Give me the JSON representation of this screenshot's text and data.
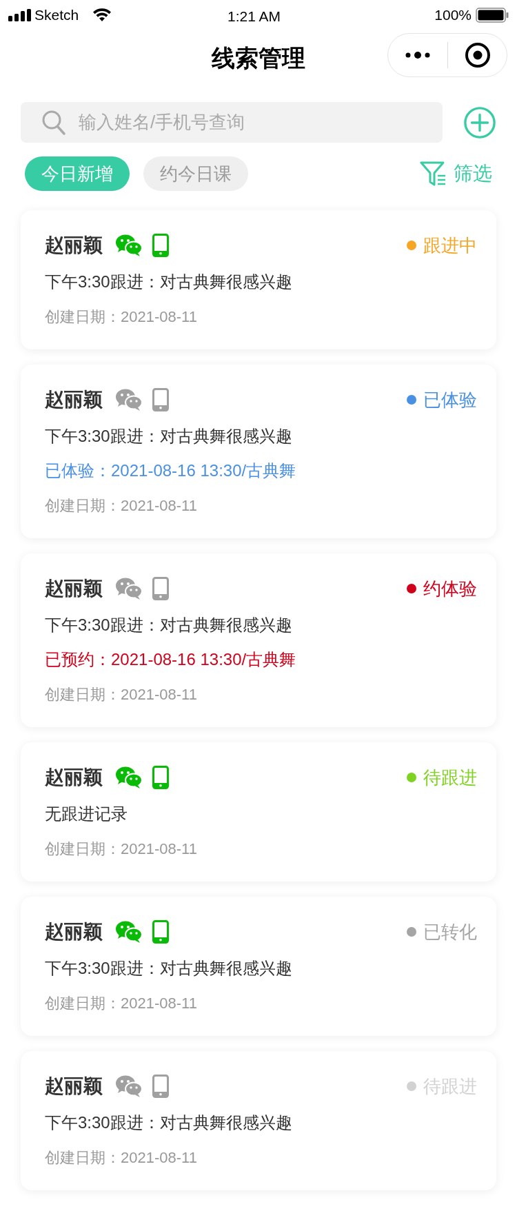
{
  "status_bar": {
    "carrier": "Sketch",
    "time": "1:21 AM",
    "battery": "100%"
  },
  "nav": {
    "title": "线索管理"
  },
  "search": {
    "placeholder": "输入姓名/手机号查询"
  },
  "chips": [
    {
      "label": "今日新增",
      "selected": true
    },
    {
      "label": "约今日课",
      "selected": false
    }
  ],
  "filter": {
    "label": "筛选"
  },
  "cards": [
    {
      "name": "赵丽颖",
      "wechat_linked": true,
      "phone_linked": true,
      "status": {
        "label": "跟进中",
        "color": "#f5a623"
      },
      "follow_up": "下午3:30跟进：对古典舞很感兴趣",
      "created": "创建日期：2021-08-11"
    },
    {
      "name": "赵丽颖",
      "wechat_linked": false,
      "phone_linked": false,
      "status": {
        "label": "已体验",
        "color": "#4a90e2"
      },
      "follow_up": "下午3:30跟进：对古典舞很感兴趣",
      "booking": {
        "text": "已体验：2021-08-16 13:30/古典舞",
        "color": "#4a90e2"
      },
      "created": "创建日期：2021-08-11"
    },
    {
      "name": "赵丽颖",
      "wechat_linked": false,
      "phone_linked": false,
      "status": {
        "label": "约体验",
        "color": "#d0021b"
      },
      "follow_up": "下午3:30跟进：对古典舞很感兴趣",
      "booking": {
        "text": "已预约：2021-08-16 13:30/古典舞",
        "color": "#d0021b"
      },
      "created": "创建日期：2021-08-11"
    },
    {
      "name": "赵丽颖",
      "wechat_linked": true,
      "phone_linked": true,
      "status": {
        "label": "待跟进",
        "color": "#7ed321"
      },
      "follow_up": "无跟进记录",
      "created": "创建日期：2021-08-11"
    },
    {
      "name": "赵丽颖",
      "wechat_linked": true,
      "phone_linked": true,
      "status": {
        "label": "已转化",
        "color": "#a5a5a5"
      },
      "follow_up": "下午3:30跟进：对古典舞很感兴趣",
      "created": "创建日期：2021-08-11"
    },
    {
      "name": "赵丽颖",
      "wechat_linked": false,
      "phone_linked": false,
      "status": {
        "label": "待跟进",
        "color": "#d2d2d2"
      },
      "follow_up": "下午3:30跟进：对古典舞很感兴趣",
      "created": "创建日期：2021-08-11"
    }
  ]
}
